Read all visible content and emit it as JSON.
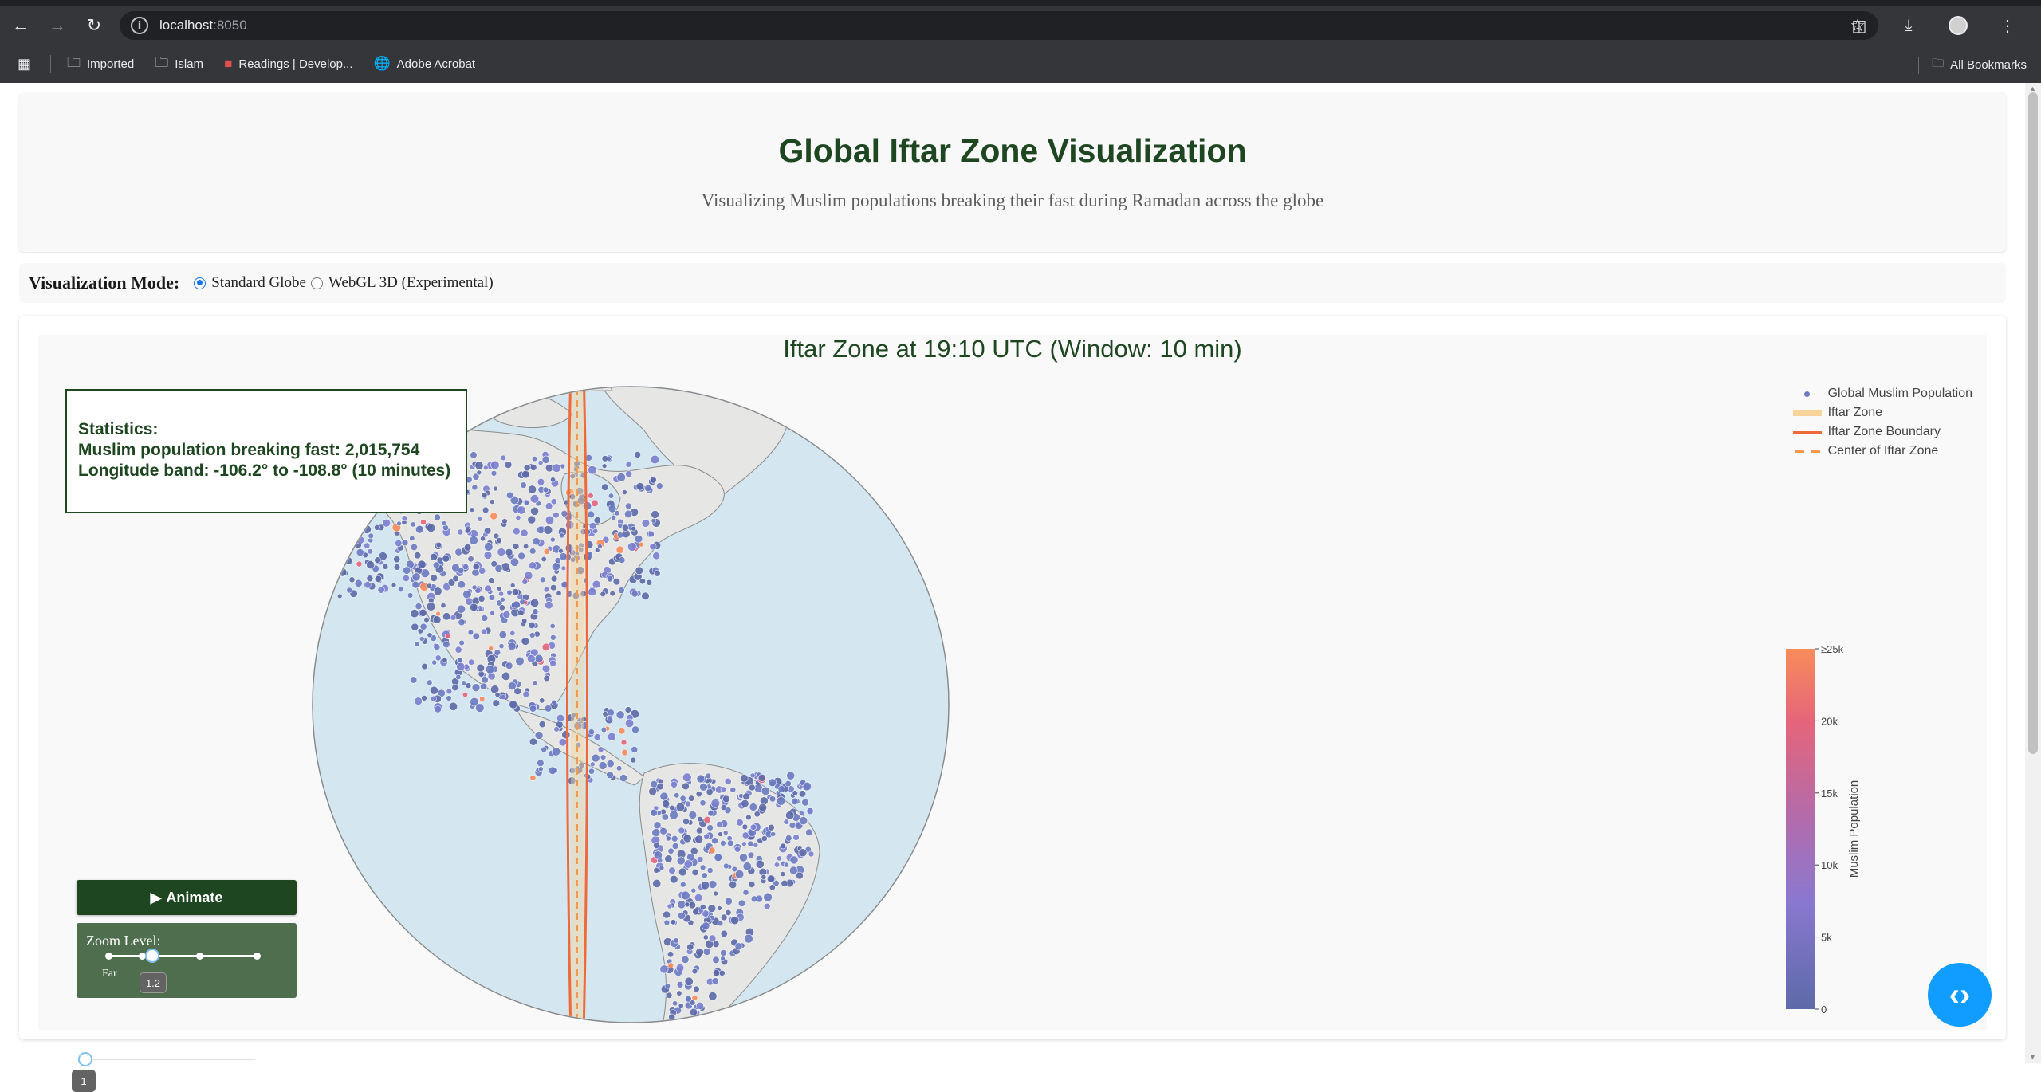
{
  "browser": {
    "url_host": "localhost",
    "url_port": ":8050",
    "bookmarks": [
      {
        "label": "Imported",
        "icon": "folder-icon"
      },
      {
        "label": "Islam",
        "icon": "folder-icon"
      },
      {
        "label": "Readings | Develop...",
        "icon": "site-icon"
      },
      {
        "label": "Adobe Acrobat",
        "icon": "globe-icon"
      }
    ],
    "all_bookmarks": "All Bookmarks"
  },
  "header": {
    "title": "Global Iftar Zone Visualization",
    "subtitle": "Visualizing Muslim populations breaking their fast during Ramadan across the globe"
  },
  "mode": {
    "label": "Visualization Mode:",
    "options": [
      "Standard Globe",
      "WebGL 3D (Experimental)"
    ],
    "selected": "Standard Globe"
  },
  "plot": {
    "title": "Iftar Zone at 19:10 UTC (Window: 10 min)",
    "stats_heading": "Statistics:",
    "stats_population": "Muslim population breaking fast: 2,015,754",
    "stats_longitude": "Longitude band: -106.2° to -108.8° (10 minutes)",
    "legend": [
      {
        "label": "Global Muslim Population",
        "color": "#6f79c2"
      },
      {
        "label": "Iftar Zone",
        "color": "#f7d49a"
      },
      {
        "label": "Iftar Zone Boundary",
        "color": "#ef6a3a"
      },
      {
        "label": "Center of Iftar Zone",
        "color": "#f39a50"
      }
    ],
    "colorbar": {
      "title": "Muslim Population",
      "ticks": [
        "≥25k",
        "20k",
        "15k",
        "10k",
        "5k",
        "0"
      ],
      "colors": [
        "#f88c5a",
        "#e5657a",
        "#b66aa8",
        "#8a78cf",
        "#6b7bc2",
        "#5d6aa9"
      ]
    }
  },
  "controls": {
    "animate_label": "Animate",
    "zoom_label": "Zoom Level:",
    "zoom_far": "Far",
    "zoom_value": "1.2",
    "zoom_fraction": 0.25,
    "speed_value": "1",
    "speed_fraction": 0.0
  },
  "chart_data": {
    "type": "scatter",
    "title": "Iftar Zone at 19:10 UTC (Window: 10 min)",
    "projection": "orthographic",
    "series": [
      {
        "name": "Global Muslim Population"
      },
      {
        "name": "Iftar Zone"
      },
      {
        "name": "Iftar Zone Boundary"
      },
      {
        "name": "Center of Iftar Zone"
      }
    ],
    "iftar_zone_longitude": [
      -108.8,
      -106.2
    ],
    "colorscale_range": [
      0,
      25000
    ],
    "colorbar_title": "Muslim Population"
  }
}
